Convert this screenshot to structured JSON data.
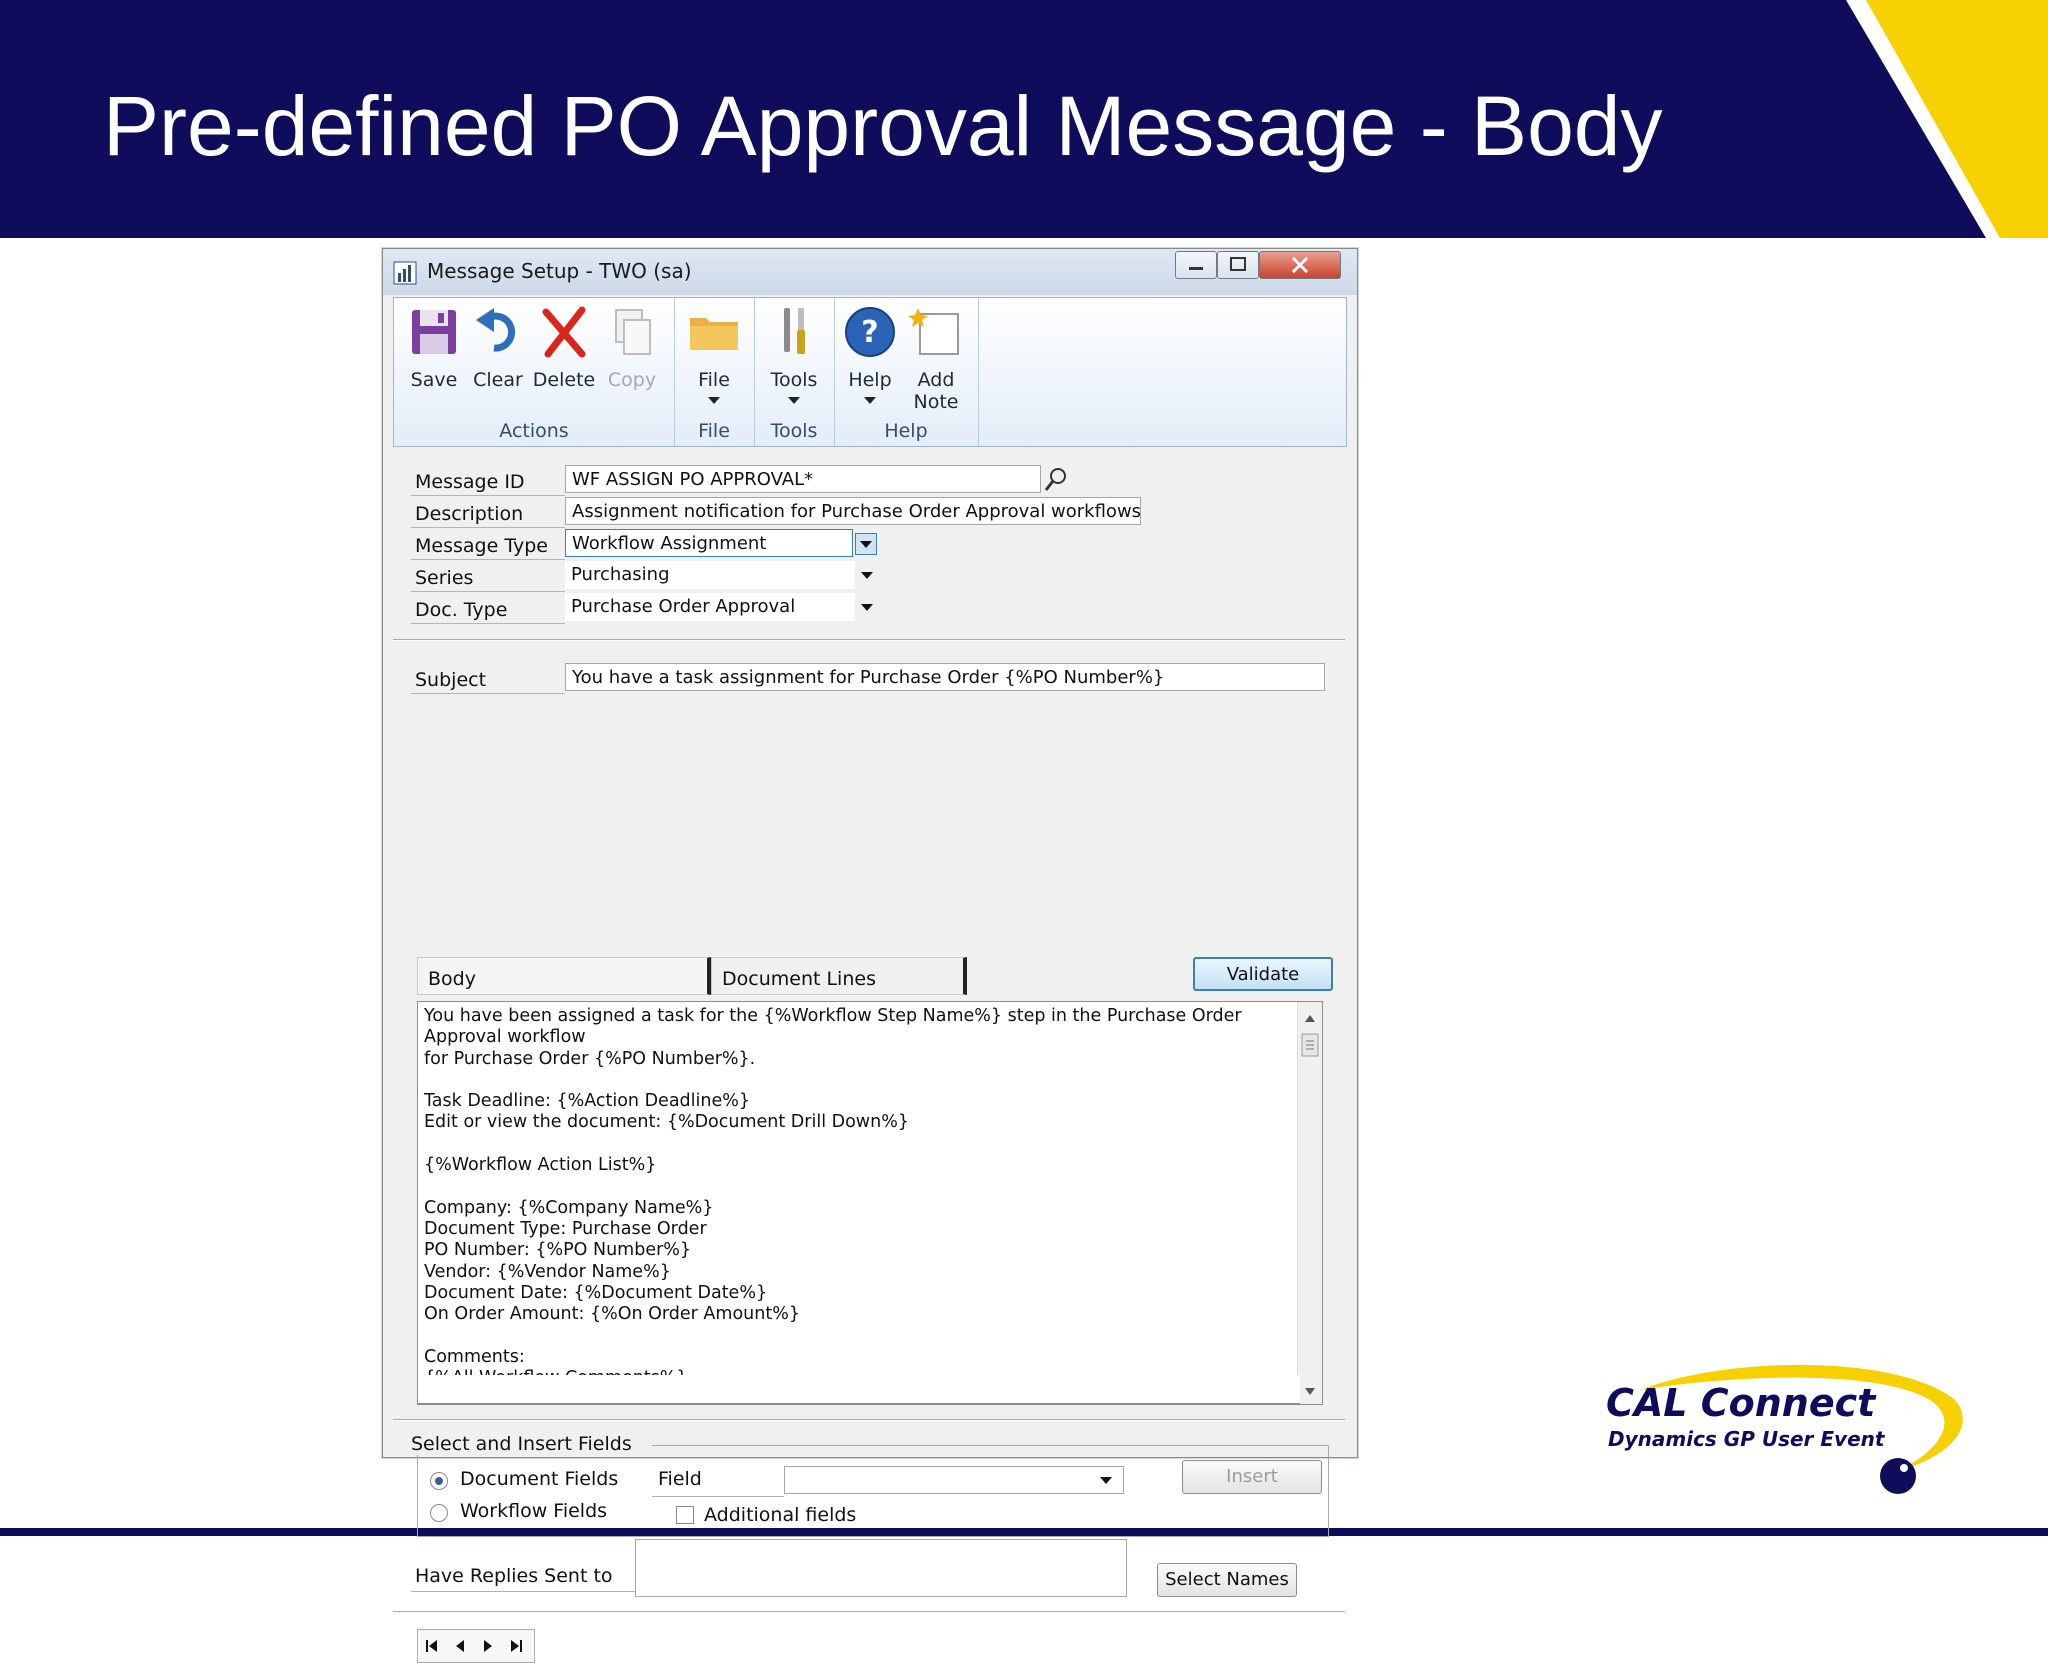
{
  "slide": {
    "title": "Pre-defined PO Approval Message - Body",
    "logo_main": "CAL Connect",
    "logo_sub": "Dynamics GP User Event",
    "colors": {
      "banner": "#0f0c5c",
      "accent_yellow": "#f7d000"
    }
  },
  "window": {
    "title": "Message Setup  -  TWO (sa)",
    "controls": [
      "minimize",
      "maximize",
      "close"
    ]
  },
  "ribbon": {
    "groups": [
      {
        "label": "Actions",
        "buttons": [
          {
            "label": "Save",
            "icon": "save-icon",
            "enabled": true
          },
          {
            "label": "Clear",
            "icon": "undo-icon",
            "enabled": true
          },
          {
            "label": "Delete",
            "icon": "delete-x-icon",
            "enabled": true
          },
          {
            "label": "Copy",
            "icon": "copy-icon",
            "enabled": false
          }
        ]
      },
      {
        "label": "File",
        "buttons": [
          {
            "label": "File",
            "icon": "folder-icon",
            "enabled": true
          }
        ]
      },
      {
        "label": "Tools",
        "buttons": [
          {
            "label": "Tools",
            "icon": "tools-icon",
            "enabled": true
          }
        ]
      },
      {
        "label": "Help",
        "buttons": [
          {
            "label": "Help",
            "icon": "help-icon",
            "enabled": true
          },
          {
            "label": "Add",
            "label2": "Note",
            "icon": "note-icon",
            "enabled": true
          }
        ]
      }
    ]
  },
  "form": {
    "message_id_label": "Message ID",
    "message_id": "WF ASSIGN PO APPROVAL*",
    "description_label": "Description",
    "description": "Assignment notification for Purchase Order Approval workflows",
    "message_type_label": "Message Type",
    "message_type": "Workflow Assignment",
    "series_label": "Series",
    "series": "Purchasing",
    "doc_type_label": "Doc. Type",
    "doc_type": "Purchase Order Approval",
    "subject_label": "Subject",
    "subject": "You have a task assignment for Purchase Order {%PO Number%}"
  },
  "tabs": {
    "body": "Body",
    "document_lines": "Document Lines",
    "validate": "Validate"
  },
  "body_text": "You have been assigned a task for the {%Workflow Step Name%} step in the Purchase Order Approval workflow\nfor Purchase Order {%PO Number%}.\n\nTask Deadline: {%Action Deadline%}\nEdit or view the document: {%Document Drill Down%}\n\n{%Workflow Action List%}\n\nCompany: {%Company Name%}\nDocument Type: Purchase Order\nPO Number: {%PO Number%}\nVendor: {%Vendor Name%}\nDocument Date: {%Document Date%}\nOn Order Amount: {%On Order Amount%}\n\nComments:\n{%All Workflow Comments%}",
  "insert_fields": {
    "group_label": "Select and Insert Fields",
    "document_fields": "Document Fields",
    "workflow_fields": "Workflow Fields",
    "selected": "Document Fields",
    "field_label": "Field",
    "field_value": "",
    "additional_fields": "Additional fields",
    "additional_checked": false,
    "insert_button": "Insert"
  },
  "replies": {
    "label": "Have Replies Sent to",
    "value": "",
    "select_names_button": "Select Names"
  }
}
